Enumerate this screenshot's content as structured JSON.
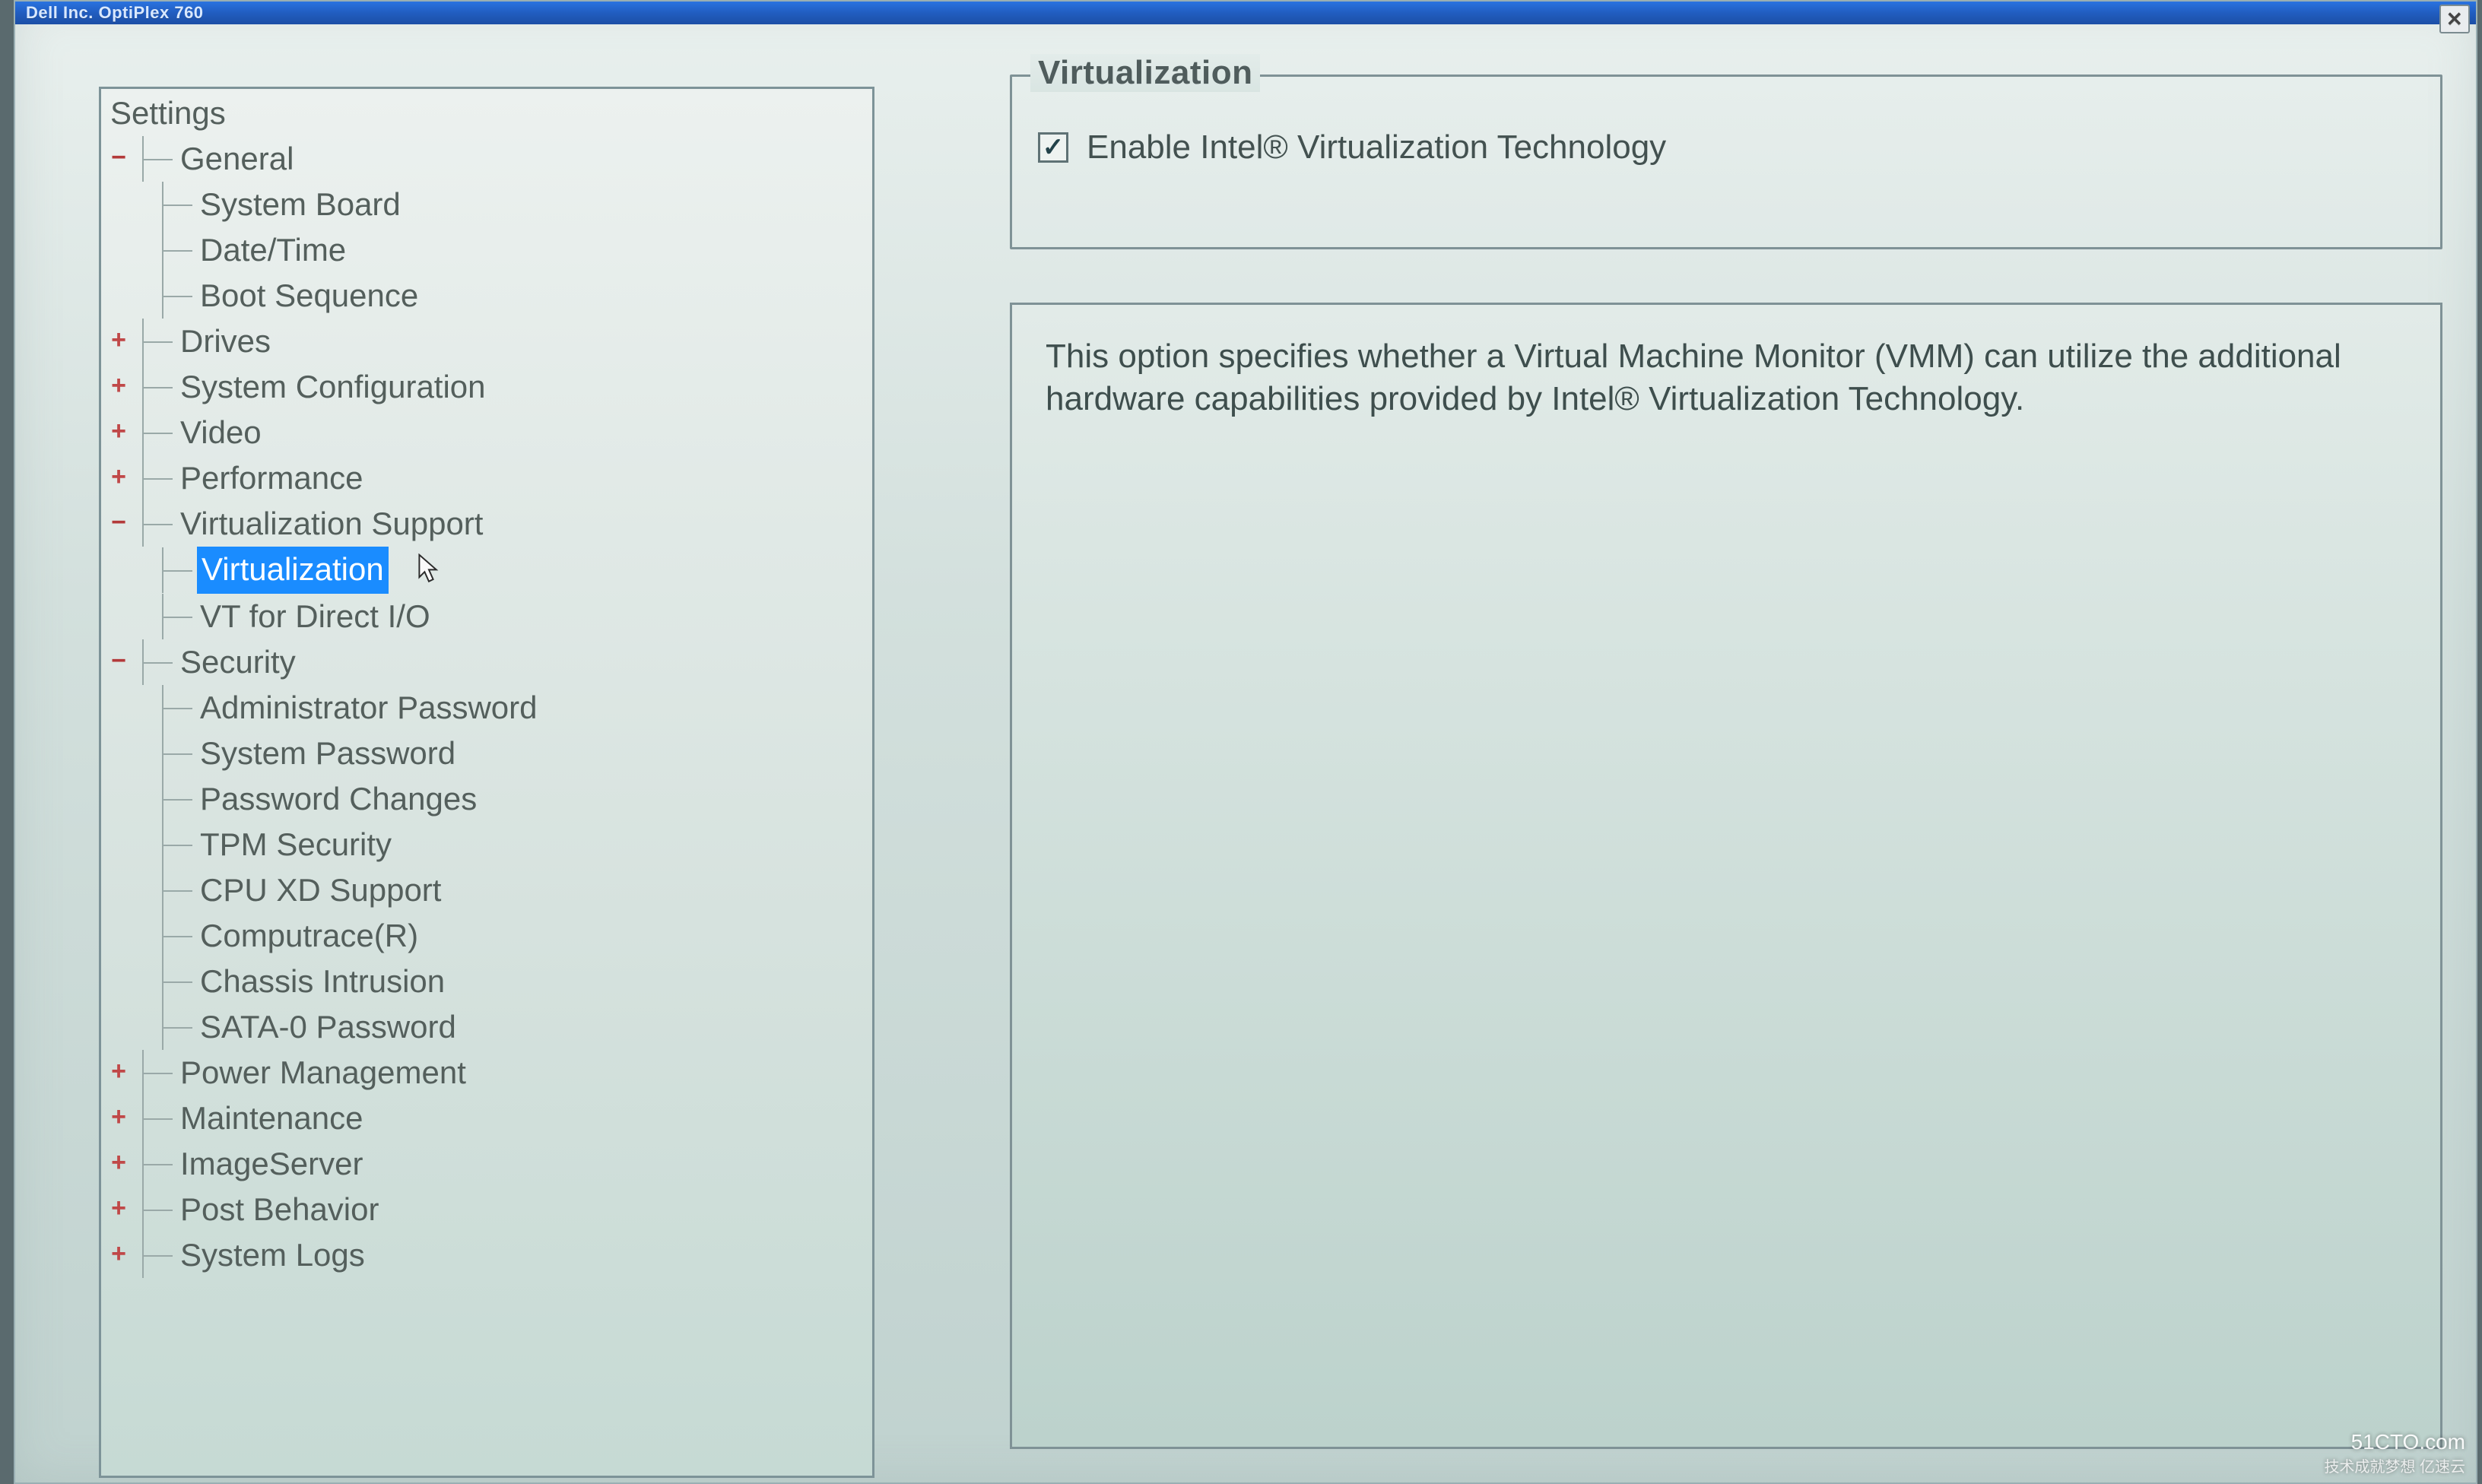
{
  "window": {
    "title": "Dell Inc. OptiPlex 760",
    "close_glyph": "✕"
  },
  "tree": {
    "root": "Settings",
    "nodes": [
      {
        "label": "General",
        "state": "open",
        "children": [
          {
            "label": "System Board"
          },
          {
            "label": "Date/Time"
          },
          {
            "label": "Boot Sequence"
          }
        ]
      },
      {
        "label": "Drives",
        "state": "closed"
      },
      {
        "label": "System Configuration",
        "state": "closed"
      },
      {
        "label": "Video",
        "state": "closed"
      },
      {
        "label": "Performance",
        "state": "closed"
      },
      {
        "label": "Virtualization Support",
        "state": "open",
        "children": [
          {
            "label": "Virtualization",
            "selected": true
          },
          {
            "label": "VT for Direct I/O"
          }
        ]
      },
      {
        "label": "Security",
        "state": "open",
        "children": [
          {
            "label": "Administrator Password"
          },
          {
            "label": "System Password"
          },
          {
            "label": "Password Changes"
          },
          {
            "label": "TPM Security"
          },
          {
            "label": "CPU XD Support"
          },
          {
            "label": "Computrace(R)"
          },
          {
            "label": "Chassis Intrusion"
          },
          {
            "label": "SATA-0 Password"
          }
        ]
      },
      {
        "label": "Power Management",
        "state": "closed"
      },
      {
        "label": "Maintenance",
        "state": "closed"
      },
      {
        "label": "ImageServer",
        "state": "closed"
      },
      {
        "label": "Post Behavior",
        "state": "closed"
      },
      {
        "label": "System Logs",
        "state": "closed"
      }
    ]
  },
  "panel": {
    "legend": "Virtualization",
    "checkbox_label": "Enable Intel® Virtualization Technology",
    "checkbox_checked": true,
    "description": "This option specifies whether a Virtual Machine Monitor (VMM) can utilize the additional hardware capabilities provided by Intel® Virtualization Technology."
  },
  "watermark": {
    "line1": "51CTO.com",
    "line2": "技术成就梦想   亿速云"
  }
}
